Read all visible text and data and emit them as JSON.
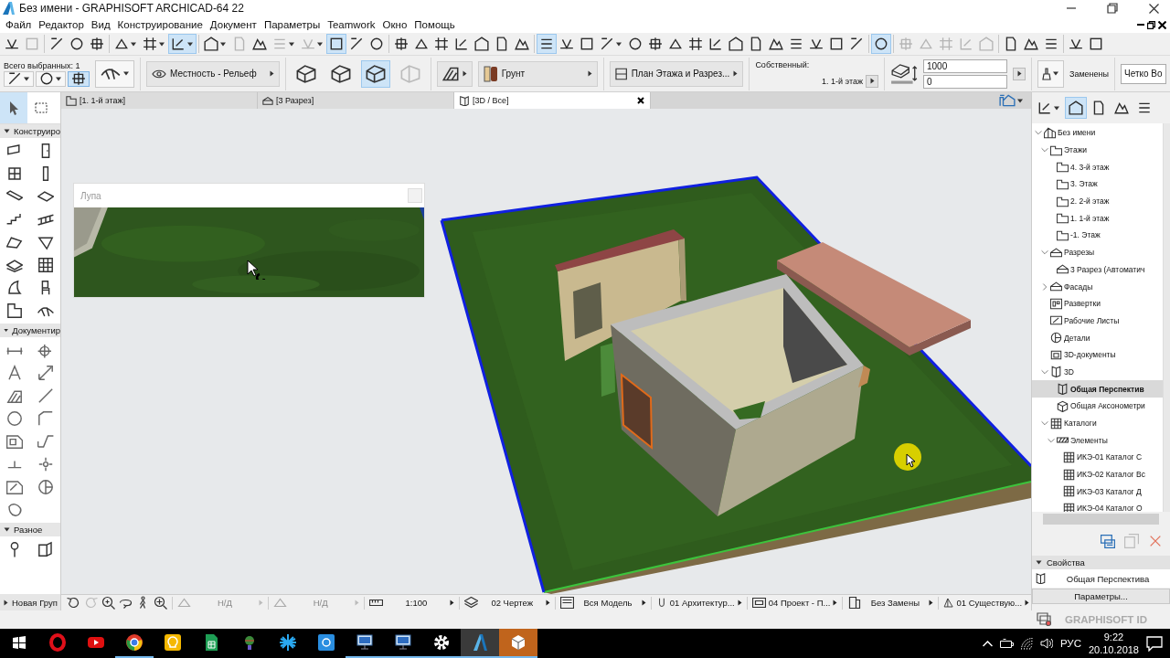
{
  "window": {
    "title": "Без имени - GRAPHISOFT ARCHICAD-64 22"
  },
  "menu": [
    "Файл",
    "Редактор",
    "Вид",
    "Конструирование",
    "Документ",
    "Параметры",
    "Teamwork",
    "Окно",
    "Помощь"
  ],
  "toolbar": {
    "groups": [
      [
        {
          "active": false,
          "disabled": false,
          "dropdown": false
        },
        {
          "active": false,
          "disabled": true,
          "dropdown": false
        }
      ],
      [
        {
          "active": false,
          "disabled": false,
          "dropdown": false
        },
        {
          "active": false,
          "disabled": false,
          "dropdown": false
        },
        {
          "active": false,
          "disabled": false,
          "dropdown": false
        }
      ],
      [
        {
          "active": false,
          "disabled": false,
          "dropdown": true
        },
        {
          "active": false,
          "disabled": false,
          "dropdown": true
        },
        {
          "active": true,
          "disabled": false,
          "dropdown": true
        }
      ],
      [
        {
          "active": false,
          "disabled": false,
          "dropdown": true
        },
        {
          "active": false,
          "disabled": true,
          "dropdown": false
        },
        {
          "active": false,
          "disabled": false,
          "dropdown": false
        },
        {
          "active": false,
          "disabled": true,
          "dropdown": true
        },
        {
          "active": false,
          "disabled": true,
          "dropdown": true
        },
        {
          "active": true,
          "disabled": false,
          "dropdown": false
        },
        {
          "active": false,
          "disabled": false,
          "dropdown": false
        },
        {
          "active": false,
          "disabled": false,
          "dropdown": false
        }
      ],
      [
        {
          "active": false,
          "disabled": false,
          "dropdown": false
        },
        {
          "active": false,
          "disabled": false,
          "dropdown": false
        },
        {
          "active": false,
          "disabled": false,
          "dropdown": false
        },
        {
          "active": false,
          "disabled": false,
          "dropdown": false
        },
        {
          "active": false,
          "disabled": false,
          "dropdown": false
        },
        {
          "active": false,
          "disabled": false,
          "dropdown": false
        },
        {
          "active": false,
          "disabled": false,
          "dropdown": false
        }
      ],
      [
        {
          "active": true,
          "disabled": false,
          "dropdown": false
        },
        {
          "active": false,
          "disabled": false,
          "dropdown": false
        },
        {
          "active": false,
          "disabled": false,
          "dropdown": false
        },
        {
          "active": false,
          "disabled": false,
          "dropdown": true
        },
        {
          "active": false,
          "disabled": false,
          "dropdown": false
        },
        {
          "active": false,
          "disabled": false,
          "dropdown": false
        },
        {
          "active": false,
          "disabled": false,
          "dropdown": false
        },
        {
          "active": false,
          "disabled": false,
          "dropdown": false
        },
        {
          "active": false,
          "disabled": false,
          "dropdown": false
        },
        {
          "active": false,
          "disabled": false,
          "dropdown": false
        },
        {
          "active": false,
          "disabled": false,
          "dropdown": false
        },
        {
          "active": false,
          "disabled": false,
          "dropdown": false
        },
        {
          "active": false,
          "disabled": false,
          "dropdown": false
        },
        {
          "active": false,
          "disabled": false,
          "dropdown": false
        },
        {
          "active": false,
          "disabled": false,
          "dropdown": false
        },
        {
          "active": false,
          "disabled": false,
          "dropdown": false
        }
      ],
      [
        {
          "active": true,
          "disabled": false,
          "dropdown": false
        }
      ],
      [
        {
          "active": false,
          "disabled": true,
          "dropdown": false
        },
        {
          "active": false,
          "disabled": true,
          "dropdown": false
        },
        {
          "active": false,
          "disabled": true,
          "dropdown": false
        },
        {
          "active": false,
          "disabled": true,
          "dropdown": false
        },
        {
          "active": false,
          "disabled": true,
          "dropdown": false
        }
      ],
      [
        {
          "active": false,
          "disabled": false,
          "dropdown": false
        },
        {
          "active": false,
          "disabled": false,
          "dropdown": false
        },
        {
          "active": false,
          "disabled": false,
          "dropdown": false
        }
      ],
      [
        {
          "active": false,
          "disabled": false,
          "dropdown": false
        },
        {
          "active": false,
          "disabled": false,
          "dropdown": false
        }
      ]
    ]
  },
  "info_box": {
    "selection_label": "Всего выбранных: 1",
    "mode_buttons": [
      {
        "active": false,
        "dropdown": true
      },
      {
        "active": false,
        "dropdown": true
      },
      {
        "active": true,
        "dropdown": false
      }
    ],
    "layer": "Местность - Рельеф",
    "geometry_buttons": [
      {
        "active": false,
        "disabled": false
      },
      {
        "active": false,
        "disabled": false
      },
      {
        "active": true,
        "disabled": false
      },
      {
        "active": false,
        "disabled": true
      }
    ],
    "surface": "Грунт",
    "structure": "План Этажа и Разрез...",
    "home_label": "Собственный:",
    "home_story": "1. 1-й этаж",
    "height_value": "1000",
    "offset_value": "0",
    "override_label": "Заменены",
    "pen_field": "Четко Во"
  },
  "tabs": [
    {
      "label": "[1. 1-й этаж]",
      "kind": "plan",
      "selected": false,
      "closable": false
    },
    {
      "label": "[3 Разрез]",
      "kind": "section",
      "selected": false,
      "closable": false
    },
    {
      "label": "[3D / Все]",
      "kind": "perspective",
      "selected": true,
      "closable": true
    }
  ],
  "toolbox": {
    "top": [
      {
        "active": true
      },
      {
        "active": false
      }
    ],
    "sections": [
      {
        "title": "Конструиро",
        "expanded": true,
        "tools": [
          {
            "kind": "wall"
          },
          {
            "kind": "door"
          },
          {
            "kind": "window"
          },
          {
            "kind": "column"
          },
          {
            "kind": "beam"
          },
          {
            "kind": "slab"
          },
          {
            "kind": "stair"
          },
          {
            "kind": "railing"
          },
          {
            "kind": "roof"
          },
          {
            "kind": "shell"
          },
          {
            "kind": "skylight"
          },
          {
            "kind": "curtain"
          },
          {
            "kind": "morph"
          },
          {
            "kind": "object"
          },
          {
            "kind": "zone"
          },
          {
            "kind": "mesh"
          }
        ]
      },
      {
        "title": "Документир",
        "expanded": true,
        "tools": [
          {
            "kind": "dimension"
          },
          {
            "kind": "level"
          },
          {
            "kind": "text"
          },
          {
            "kind": "label"
          },
          {
            "kind": "fill"
          },
          {
            "kind": "line"
          },
          {
            "kind": "circle"
          },
          {
            "kind": "polyline"
          },
          {
            "kind": "drawing"
          },
          {
            "kind": "section"
          },
          {
            "kind": "elevation"
          },
          {
            "kind": "marker"
          },
          {
            "kind": "worksheet"
          },
          {
            "kind": "detail"
          },
          {
            "kind": "change"
          }
        ]
      },
      {
        "title": "Разное",
        "expanded": true,
        "tools": [
          {
            "kind": "grid"
          },
          {
            "kind": "interior"
          }
        ]
      },
      {
        "title": "Новая Груп",
        "expanded": false
      }
    ]
  },
  "lupa": {
    "title": "Лупа"
  },
  "navigator": {
    "buttons": [
      {
        "active": false,
        "dropdown": true
      },
      {
        "active": true,
        "dropdown": false
      },
      {
        "active": false,
        "dropdown": false
      },
      {
        "active": false,
        "dropdown": false
      },
      {
        "active": false,
        "dropdown": false
      }
    ],
    "tree": [
      {
        "label": "Без имени",
        "kind": "project",
        "expanded": true,
        "selected": false,
        "children": [
          {
            "label": "Этажи",
            "kind": "storey",
            "expanded": true,
            "selected": false,
            "children": [
              {
                "label": "4. 3-й этаж",
                "kind": "storey",
                "selected": false
              },
              {
                "label": "3. Этаж",
                "kind": "storey",
                "selected": false
              },
              {
                "label": "2. 2-й этаж",
                "kind": "storey",
                "selected": false
              },
              {
                "label": "1. 1-й этаж",
                "kind": "storey",
                "selected": false
              },
              {
                "label": "-1. Этаж",
                "kind": "storey",
                "selected": false
              }
            ]
          },
          {
            "label": "Разрезы",
            "kind": "section",
            "expanded": true,
            "selected": false,
            "children": [
              {
                "label": "3 Разрез (Автоматич",
                "kind": "section",
                "selected": false
              }
            ]
          },
          {
            "label": "Фасады",
            "kind": "section",
            "expanded": false,
            "selected": false
          },
          {
            "label": "Развертки",
            "kind": "interior",
            "selected": false
          },
          {
            "label": "Рабочие Листы",
            "kind": "worksheet",
            "selected": false
          },
          {
            "label": "Детали",
            "kind": "detail",
            "selected": false
          },
          {
            "label": "3D-документы",
            "kind": "document",
            "selected": false
          },
          {
            "label": "3D",
            "kind": "perspective",
            "expanded": true,
            "selected": false,
            "children": [
              {
                "label": "Общая Перспектив",
                "kind": "perspective",
                "selected": true
              },
              {
                "label": "Общая Аксонометри",
                "kind": "axon",
                "selected": false
              }
            ]
          },
          {
            "label": "Каталоги",
            "kind": "schedule",
            "expanded": true,
            "selected": false,
            "children": [
              {
                "label": "Элементы",
                "kind": "elements",
                "expanded": true,
                "selected": false,
                "children": [
                  {
                    "label": "ИКЭ-01 Каталог С",
                    "kind": "schedule",
                    "selected": false
                  },
                  {
                    "label": "ИКЭ-02 Каталог Вс",
                    "kind": "schedule",
                    "selected": false
                  },
                  {
                    "label": "ИКЭ-03 Каталог Д",
                    "kind": "schedule",
                    "selected": false
                  },
                  {
                    "label": "ИКЭ-04 Каталог О",
                    "kind": "schedule",
                    "selected": false
                  }
                ]
              }
            ]
          }
        ]
      }
    ],
    "actions": [
      {
        "kind": "settings",
        "disabled": false
      },
      {
        "kind": "clone",
        "disabled": true
      },
      {
        "kind": "delete",
        "disabled": false
      }
    ]
  },
  "properties": {
    "title": "Свойства",
    "expanded": true,
    "view_name": "Общая Перспектива",
    "button": "Параметры..."
  },
  "status_bar": {
    "view_buttons": [
      {
        "kind": "back",
        "disabled": false
      },
      {
        "kind": "forward",
        "disabled": true
      },
      {
        "kind": "zoomin",
        "disabled": false
      },
      {
        "kind": "orbit",
        "disabled": false
      },
      {
        "kind": "walk",
        "disabled": false
      },
      {
        "kind": "fit",
        "disabled": false
      }
    ],
    "items": [
      {
        "kind": "angle",
        "text": "Н/Д",
        "disabled": true
      },
      {
        "kind": "angle",
        "text": "Н/Д",
        "disabled": true
      },
      {
        "kind": "scale",
        "text": "1:100",
        "disabled": false
      },
      {
        "kind": "layers",
        "text": "02 Чертеж",
        "disabled": false
      },
      {
        "kind": "model",
        "text": "Вся Модель",
        "disabled": false
      },
      {
        "kind": "pen",
        "text": "01 Архитектур...",
        "disabled": false
      },
      {
        "kind": "view",
        "text": "04 Проект - П...",
        "disabled": false
      },
      {
        "kind": "override",
        "text": "Без Замены",
        "disabled": false
      },
      {
        "kind": "renovation",
        "text": "01 Существую...",
        "disabled": false
      }
    ]
  },
  "graphisoft_id": "GRAPHISOFT ID",
  "taskbar": {
    "apps": [
      {
        "kind": "opera",
        "running": false,
        "focused": false
      },
      {
        "kind": "youtube",
        "running": false,
        "focused": false
      },
      {
        "kind": "chrome",
        "running": true,
        "focused": false
      },
      {
        "kind": "bulb",
        "running": false,
        "focused": false
      },
      {
        "kind": "sheets",
        "running": false,
        "focused": false
      },
      {
        "kind": "globe",
        "running": false,
        "focused": false
      },
      {
        "kind": "star",
        "running": false,
        "focused": false
      },
      {
        "kind": "mail",
        "running": false,
        "focused": false
      },
      {
        "kind": "monitor",
        "running": true,
        "focused": false
      },
      {
        "kind": "monitor",
        "running": true,
        "focused": false
      },
      {
        "kind": "gear",
        "running": true,
        "focused": false
      },
      {
        "kind": "archicad",
        "running": true,
        "focused": true
      },
      {
        "kind": "cube",
        "running": true,
        "focused": true
      }
    ],
    "language": "РУС",
    "time": "9:22",
    "date": "20.10.2018"
  }
}
